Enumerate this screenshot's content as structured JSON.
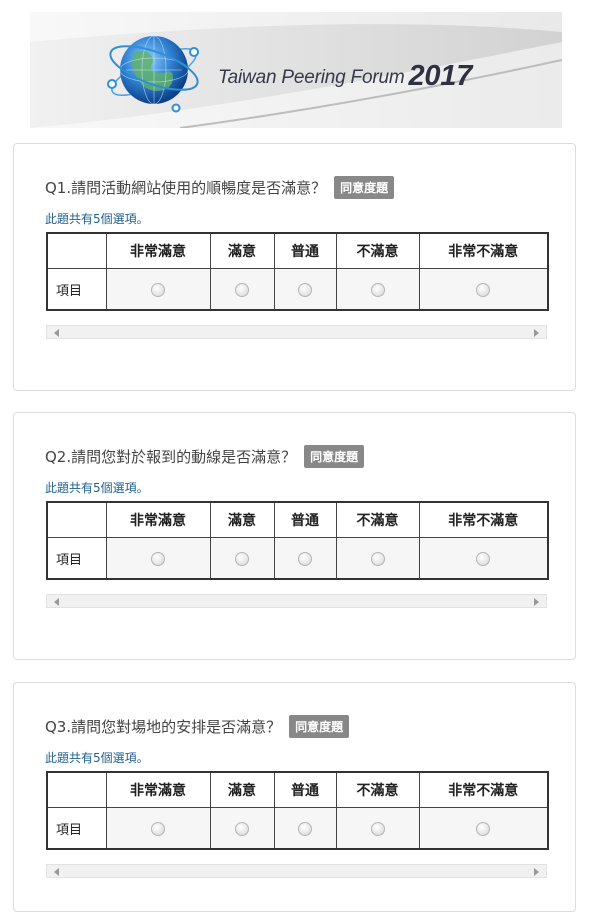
{
  "banner": {
    "title": "Taiwan Peering Forum",
    "year": "2017"
  },
  "columns": [
    "非常滿意",
    "滿意",
    "普通",
    "不滿意",
    "非常不滿意"
  ],
  "questions": [
    {
      "title": "Q1.請問活動網站使用的順暢度是否滿意？",
      "badge": "同意度題",
      "note": "此題共有5個選項。",
      "row_label": "項目"
    },
    {
      "title": "Q2.請問您對於報到的動線是否滿意？",
      "badge": "同意度題",
      "note": "此題共有5個選項。",
      "row_label": "項目"
    },
    {
      "title": "Q3.請問您對場地的安排是否滿意？",
      "badge": "同意度題",
      "note": "此題共有5個選項。",
      "row_label": "項目"
    }
  ]
}
